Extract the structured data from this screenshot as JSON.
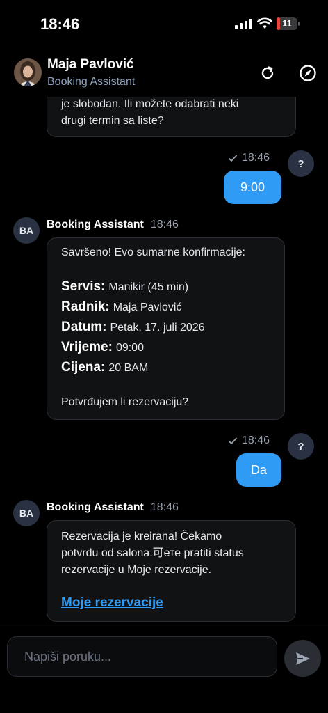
{
  "status_bar": {
    "time": "18:46",
    "battery": "11",
    "battery_level": 0.11
  },
  "header": {
    "name": "Maja Pavlović",
    "subtitle": "Booking Assistant"
  },
  "messages": {
    "m1": {
      "lines": [
        "je slobodan. Ili možete odabrati neki",
        "drugi termin sa liste?"
      ]
    },
    "m2": {
      "time": "18:46",
      "text": "9:00",
      "avatar": "?"
    },
    "m3": {
      "avatar": "BA",
      "sender": "Booking Assistant",
      "time": "18:46",
      "intro": "Savršeno! Evo sumarne konfirmacije:",
      "rows": [
        {
          "label": "Servis:",
          "value": "Manikir (45 min)"
        },
        {
          "label": "Radnik:",
          "value": "Maja Pavlović"
        },
        {
          "label": "Datum:",
          "value": "Petak, 17. juli 2026"
        },
        {
          "label": "Vrijeme:",
          "value": "09:00"
        },
        {
          "label": "Cijena:",
          "value": "20 BAM"
        }
      ],
      "question": "Potvrđujem li rezervaciju?"
    },
    "m4": {
      "time": "18:46",
      "text": "Da",
      "avatar": "?"
    },
    "m5": {
      "avatar": "BA",
      "sender": "Booking Assistant",
      "time": "18:46",
      "lines": [
        "Rezervacija je kreirana! Čekamo",
        "potvrdu od salona.可ете pratiti status",
        "rezervacije u Moje rezervacije."
      ],
      "link": "Moje rezervacije"
    }
  },
  "composer": {
    "placeholder": "Napiši poruku..."
  },
  "icons": {
    "refresh": "refresh-icon",
    "compass": "compass-icon",
    "send": "send-icon",
    "check": "check-icon",
    "signal": "signal-icon",
    "wifi": "wifi-icon",
    "battery": "battery-icon"
  },
  "colors": {
    "accent": "#2f9bf5",
    "background": "#000000",
    "bubble_in": "#111214",
    "battery": "#e5453a"
  }
}
